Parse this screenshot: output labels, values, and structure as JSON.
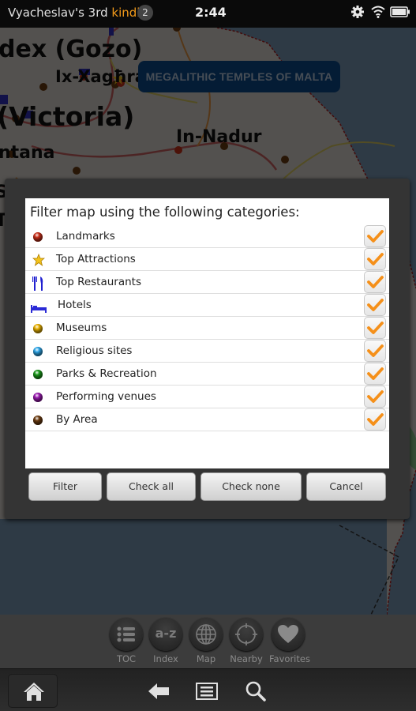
{
  "status_bar": {
    "device_name": "Vyacheslav's 3rd",
    "brand": "kindle",
    "notification_count": "2",
    "time": "2:44",
    "icons": [
      "gear-icon",
      "wifi-icon",
      "battery-icon"
    ]
  },
  "map": {
    "place_labels": [
      "dex (Gozo)",
      "Ix-Xagħra",
      "(Victoria)",
      "In-Nadur",
      "ntana",
      "S",
      "T"
    ],
    "banner": "MEGALITHIC TEMPLES OF MALTA"
  },
  "dialog": {
    "heading": "Filter map using the following categories:",
    "categories": [
      {
        "label": "Landmarks",
        "icon": "red-ball-icon",
        "color": "#c8301a",
        "checked": true
      },
      {
        "label": "Top Attractions",
        "icon": "star-icon",
        "color": "#f2c21b",
        "checked": true
      },
      {
        "label": "Top Restaurants",
        "icon": "fork-knife-icon",
        "color": "#2020d0",
        "checked": true
      },
      {
        "label": "Hotels",
        "icon": "bed-icon",
        "color": "#2a2ad6",
        "checked": true
      },
      {
        "label": "Museums",
        "icon": "yellow-ball-icon",
        "color": "#e8b000",
        "checked": true
      },
      {
        "label": "Religious sites",
        "icon": "blue-ball-icon",
        "color": "#2ea6e8",
        "checked": true
      },
      {
        "label": "Parks & Recreation",
        "icon": "green-ball-icon",
        "color": "#1a9a1a",
        "checked": true
      },
      {
        "label": "Performing venues",
        "icon": "purple-ball-icon",
        "color": "#9a1ab0",
        "checked": true
      },
      {
        "label": "By Area",
        "icon": "brown-ball-icon",
        "color": "#6a3a10",
        "checked": true
      }
    ],
    "buttons": {
      "filter": "Filter",
      "check_all": "Check all",
      "check_none": "Check none",
      "cancel": "Cancel"
    },
    "check_color": "#f5901a"
  },
  "nav": {
    "items": [
      {
        "label": "TOC",
        "icon": "toc-list-icon"
      },
      {
        "label": "Index",
        "icon": "az-index-icon"
      },
      {
        "label": "Map",
        "icon": "globe-icon"
      },
      {
        "label": "Nearby",
        "icon": "crosshair-icon"
      },
      {
        "label": "Favorites",
        "icon": "heart-icon"
      }
    ],
    "index_glyph": "a-z"
  },
  "bottom_bar": {
    "icons": [
      "home-icon",
      "back-arrow-icon",
      "menu-icon",
      "search-icon"
    ]
  }
}
